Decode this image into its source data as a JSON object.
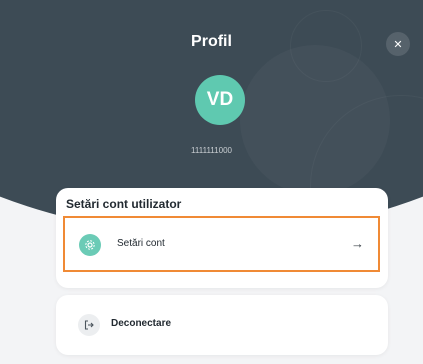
{
  "header": {
    "title": "Profil",
    "avatar_initials": "VD",
    "phone": "1111111000",
    "close_icon_glyph": "✕"
  },
  "account_card": {
    "title": "Setări cont utilizator",
    "item_label": "Setări cont",
    "item_icon": "gear-icon",
    "arrow_glyph": "→"
  },
  "logout": {
    "label": "Deconectare",
    "icon_glyph": "↦"
  },
  "colors": {
    "header_bg": "#3d4b55",
    "accent_teal": "#5fc9b0",
    "highlight_orange": "#f08a35"
  }
}
